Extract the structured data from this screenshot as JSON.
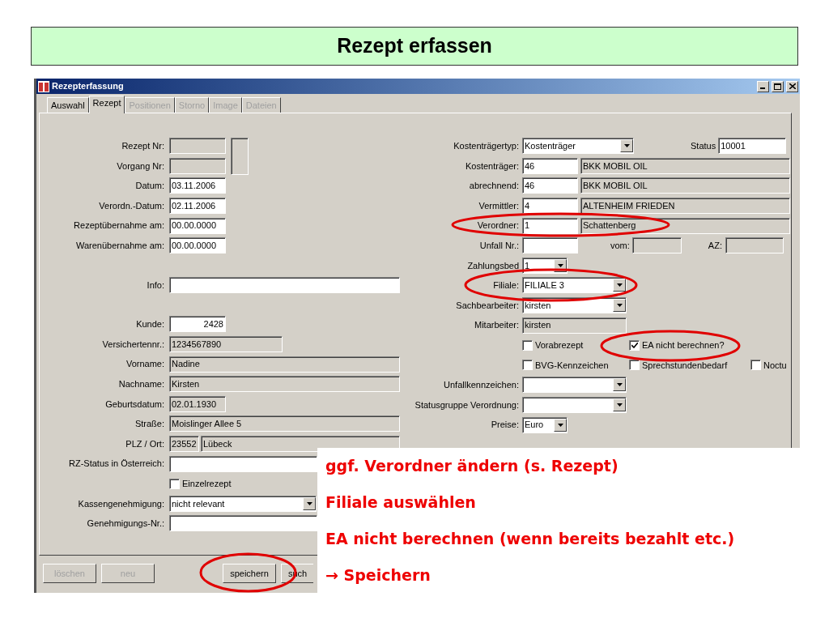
{
  "slide_title": "Rezept erfassen",
  "window": {
    "title": "Rezepterfassung"
  },
  "tabs": [
    {
      "label": "Auswahl",
      "selected": false,
      "disabled": false
    },
    {
      "label": "Rezept",
      "selected": true,
      "disabled": false
    },
    {
      "label": "Positionen",
      "selected": false,
      "disabled": true
    },
    {
      "label": "Storno",
      "selected": false,
      "disabled": true
    },
    {
      "label": "Image",
      "selected": false,
      "disabled": true
    },
    {
      "label": "Dateien",
      "selected": false,
      "disabled": true
    }
  ],
  "left_groups": [
    [
      {
        "kind": "number",
        "label": "Rezept Nr:"
      },
      {
        "kind": "short_display",
        "label": "Vorgang Nr:"
      },
      {
        "kind": "short_input",
        "label": "Datum:",
        "value": "03.11.2006"
      },
      {
        "kind": "short_input",
        "label": "Verordn.-Datum:",
        "value": "02.11.2006"
      },
      {
        "kind": "short_input",
        "label": "Rezeptübernahme am:",
        "value": "00.00.0000"
      },
      {
        "kind": "short_input",
        "label": "Warenübernahme am:",
        "value": "00.00.0000"
      }
    ],
    [
      {
        "kind": "wide_input",
        "label": "Info:"
      }
    ],
    [
      {
        "kind": "number_input",
        "label": "Kunde:",
        "value": "2428"
      },
      {
        "kind": "mid_display",
        "label": "Versichertennr.:",
        "value": "1234567890"
      },
      {
        "kind": "wide_display",
        "label": "Vorname:",
        "value": "Nadine"
      },
      {
        "kind": "wide_display",
        "label": "Nachname:",
        "value": "Kirsten"
      },
      {
        "kind": "short_display",
        "label": "Geburtsdatum:",
        "value": "02.01.1930"
      },
      {
        "kind": "wide_display",
        "label": "Straße:",
        "value": "Moislinger Allee 5"
      },
      {
        "kind": "zip_city",
        "label": "PLZ / Ort:",
        "zip": "23552",
        "city": "Lübeck"
      },
      {
        "kind": "covered_input",
        "label": "RZ-Status in Österreich:"
      },
      {
        "kind": "checkbox",
        "check": "Einzelrezept",
        "checked": false
      },
      {
        "kind": "select",
        "label": "Kassengenehmigung:",
        "value": "nicht relevant"
      },
      {
        "kind": "covered_input",
        "label": "Genehmigungs-Nr.:"
      }
    ]
  ],
  "right_rows": [
    {
      "kind": "type_status",
      "label": "Kostenträgertyp:",
      "value": "Kostenträger",
      "status_label": "Status",
      "status_value": "10001"
    },
    {
      "kind": "code_name",
      "label": "Kostenträger:",
      "code": "46",
      "name": "BKK MOBIL OIL"
    },
    {
      "kind": "code_name",
      "label": "abrechnend:",
      "code": "46",
      "name": "BKK MOBIL OIL"
    },
    {
      "kind": "code_name",
      "label": "Vermittler:",
      "code": "4",
      "name": "ALTENHEIM FRIEDEN"
    },
    {
      "kind": "code_name",
      "label": "Verordner:",
      "code": "1",
      "name": "Schattenberg"
    },
    {
      "kind": "accident",
      "label": "Unfall Nr.:",
      "from_label": "vom:",
      "az_label": "AZ:"
    },
    {
      "kind": "narrow_select",
      "label": "Zahlungsbed",
      "value": "1"
    },
    {
      "kind": "select",
      "label": "Filiale:",
      "value": "FILIALE 3"
    },
    {
      "kind": "select",
      "label": "Sachbearbeiter:",
      "value": "kirsten"
    },
    {
      "kind": "display",
      "label": "Mitarbeiter:",
      "value": "kirsten"
    },
    {
      "kind": "checks",
      "checks": [
        {
          "label": "Vorabrezept",
          "checked": false
        },
        {
          "label": "EA nicht berechnen?",
          "checked": true
        }
      ]
    },
    {
      "kind": "checks",
      "checks": [
        {
          "label": "BVG-Kennzeichen",
          "checked": false
        },
        {
          "label": "Sprechstundenbedarf",
          "checked": false
        },
        {
          "label": "Noctu",
          "checked": false
        }
      ]
    },
    {
      "kind": "select",
      "label": "Unfallkennzeichen:"
    },
    {
      "kind": "select",
      "label": "Statusgruppe Verordnung:"
    },
    {
      "kind": "narrow_select",
      "label": "Preise:",
      "value": "Euro"
    }
  ],
  "buttons": [
    {
      "label": "löschen",
      "disabled": true
    },
    {
      "label": "neu",
      "disabled": true
    },
    {
      "label": "speichern",
      "disabled": false
    },
    {
      "label": "such",
      "disabled": false
    }
  ],
  "callout": [
    "ggf. Verordner ändern (s. Rezept)",
    "Filiale auswählen",
    "EA nicht berechnen (wenn bereits bezahlt etc.)",
    "→ Speichern"
  ]
}
